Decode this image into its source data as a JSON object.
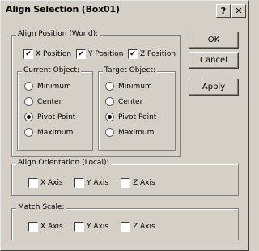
{
  "title": "Align Selection (Box01)",
  "title_buttons": {
    "help": "?",
    "close": "✕"
  },
  "buttons": {
    "ok": "OK",
    "cancel": "Cancel",
    "apply": "Apply"
  },
  "align_position": {
    "label": "Align Position (World):",
    "x": {
      "label": "X Position",
      "checked": true
    },
    "y": {
      "label": "Y Position",
      "checked": true
    },
    "z": {
      "label": "Z Position",
      "checked": true
    },
    "current": {
      "label": "Current Object:",
      "options": [
        "Minimum",
        "Center",
        "Pivot Point",
        "Maximum"
      ],
      "selected": "Pivot Point"
    },
    "target": {
      "label": "Target Object:",
      "options": [
        "Minimum",
        "Center",
        "Pivot Point",
        "Maximum"
      ],
      "selected": "Pivot Point"
    }
  },
  "align_orientation": {
    "label": "Align Orientation (Local):",
    "x": {
      "label": "X Axis",
      "checked": false
    },
    "y": {
      "label": "Y Axis",
      "checked": false
    },
    "z": {
      "label": "Z Axis",
      "checked": false
    }
  },
  "match_scale": {
    "label": "Match Scale:",
    "x": {
      "label": "X Axis",
      "checked": false
    },
    "y": {
      "label": "Y Axis",
      "checked": false
    },
    "z": {
      "label": "Z Axis",
      "checked": false
    }
  }
}
